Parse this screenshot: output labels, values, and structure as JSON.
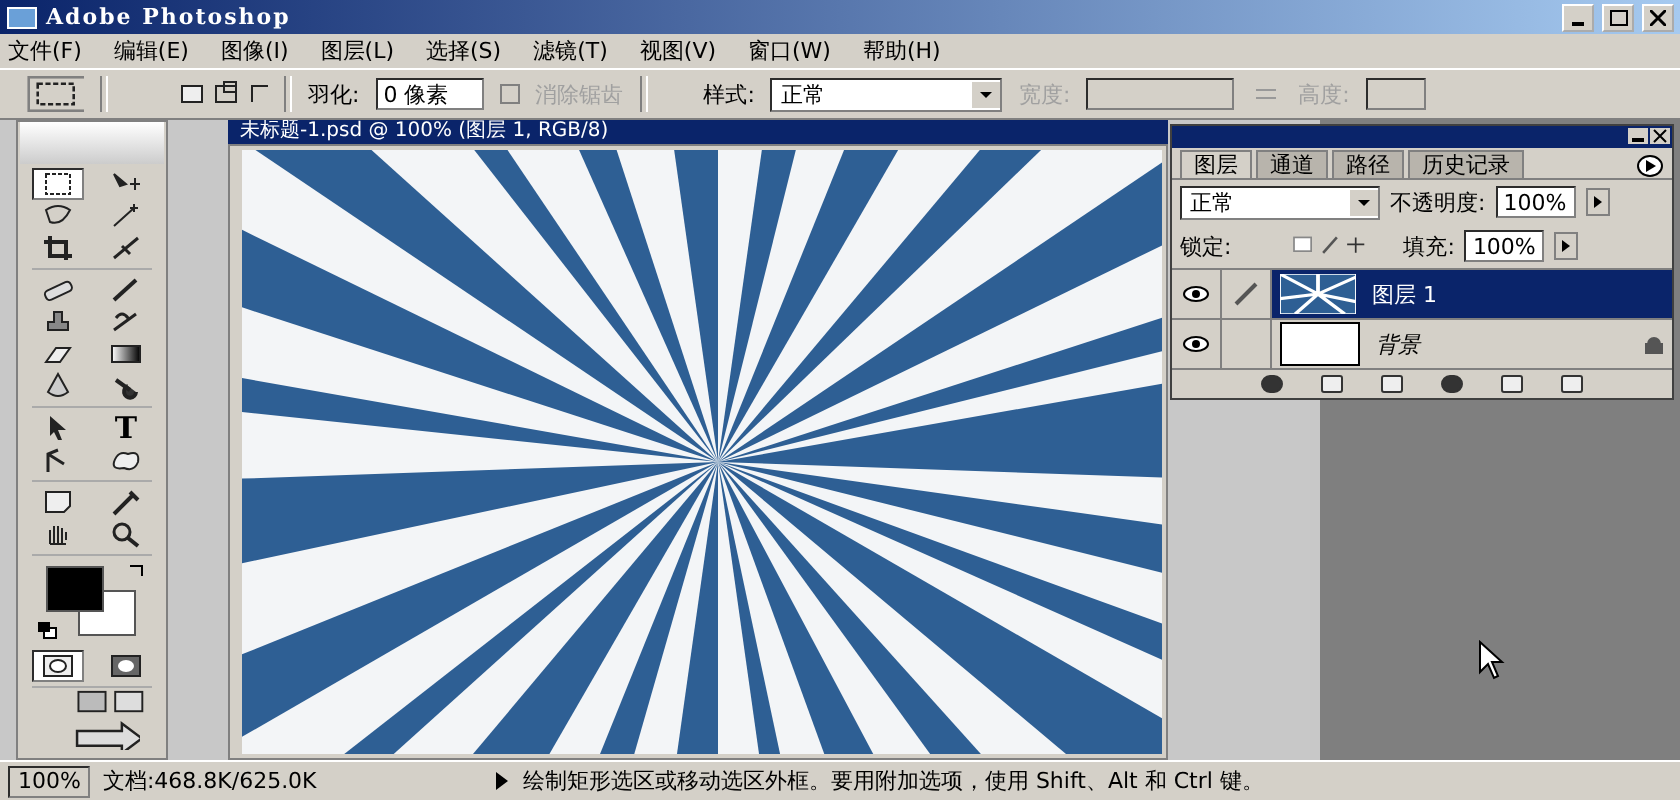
{
  "window": {
    "title": "Adobe Photoshop"
  },
  "menu": [
    {
      "label": "文件(F)"
    },
    {
      "label": "编辑(E)"
    },
    {
      "label": "图像(I)"
    },
    {
      "label": "图层(L)"
    },
    {
      "label": "选择(S)"
    },
    {
      "label": "滤镜(T)"
    },
    {
      "label": "视图(V)"
    },
    {
      "label": "窗口(W)"
    },
    {
      "label": "帮助(H)"
    }
  ],
  "options": {
    "feather_label": "羽化:",
    "feather_value": "0 像素",
    "anti_alias": {
      "label": "消除锯齿",
      "checked": false,
      "disabled": true
    },
    "style_label": "样式:",
    "style_value": "正常",
    "width": {
      "label": "宽度:",
      "disabled": true
    },
    "height": {
      "label": "高度:",
      "disabled": true
    }
  },
  "toolbox": {
    "type_tool_glyph": "T"
  },
  "document": {
    "title": "未标题-1.psd @ 100% (图层 1, RGB/8)"
  },
  "layers_panel": {
    "tabs": [
      {
        "label": "图层",
        "selected": true
      },
      {
        "label": "通道",
        "selected": false
      },
      {
        "label": "路径",
        "selected": false
      },
      {
        "label": "历史记录",
        "selected": false
      }
    ],
    "blend_mode": "正常",
    "opacity_label": "不透明度:",
    "opacity": "100%",
    "lock_label": "锁定:",
    "fill_label": "填充:",
    "fill": "100%",
    "layers": [
      {
        "name": "图层 1",
        "kind": "layer",
        "selected": true,
        "visible": true
      },
      {
        "name": "背景",
        "kind": "background",
        "selected": false,
        "visible": true
      }
    ]
  },
  "status_bar": {
    "zoom": "100%",
    "document_size": "文档:468.8K/625.0K",
    "hint": "绘制矩形选区或移动选区外框。要用附加选项，使用 Shift、Alt 和 Ctrl 键。"
  }
}
